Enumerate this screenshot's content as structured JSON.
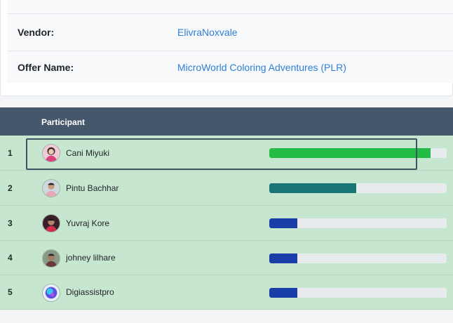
{
  "offer_info": {
    "rows": [
      {
        "label": "Vendor:",
        "value": "ElivraNoxvale"
      },
      {
        "label": "Offer Name:",
        "value": "MicroWorld Coloring Adventures (PLR)"
      }
    ]
  },
  "leaderboard": {
    "header": {
      "participant": "Participant"
    },
    "rows": [
      {
        "rank": "1",
        "name": "Cani Miyuki",
        "progress": 0.91,
        "bar_color": "#22bb44",
        "avatar_icon": "woman-avatar-icon"
      },
      {
        "rank": "2",
        "name": "Pintu Bachhar",
        "progress": 0.49,
        "bar_color": "#1a7575",
        "avatar_icon": "man-avatar-icon"
      },
      {
        "rank": "3",
        "name": "Yuvraj Kore",
        "progress": 0.16,
        "bar_color": "#1a3ea8",
        "avatar_icon": "man-avatar-icon"
      },
      {
        "rank": "4",
        "name": "johney lilhare",
        "progress": 0.16,
        "bar_color": "#1a3ea8",
        "avatar_icon": "man-avatar-icon"
      },
      {
        "rank": "5",
        "name": "Digiassistpro",
        "progress": 0.16,
        "bar_color": "#1a3ea8",
        "avatar_icon": "logo-avatar-icon"
      }
    ]
  },
  "colors": {
    "header_bg": "#45586b",
    "row_bg": "#c6e6cf",
    "link": "#2f7fd7"
  }
}
